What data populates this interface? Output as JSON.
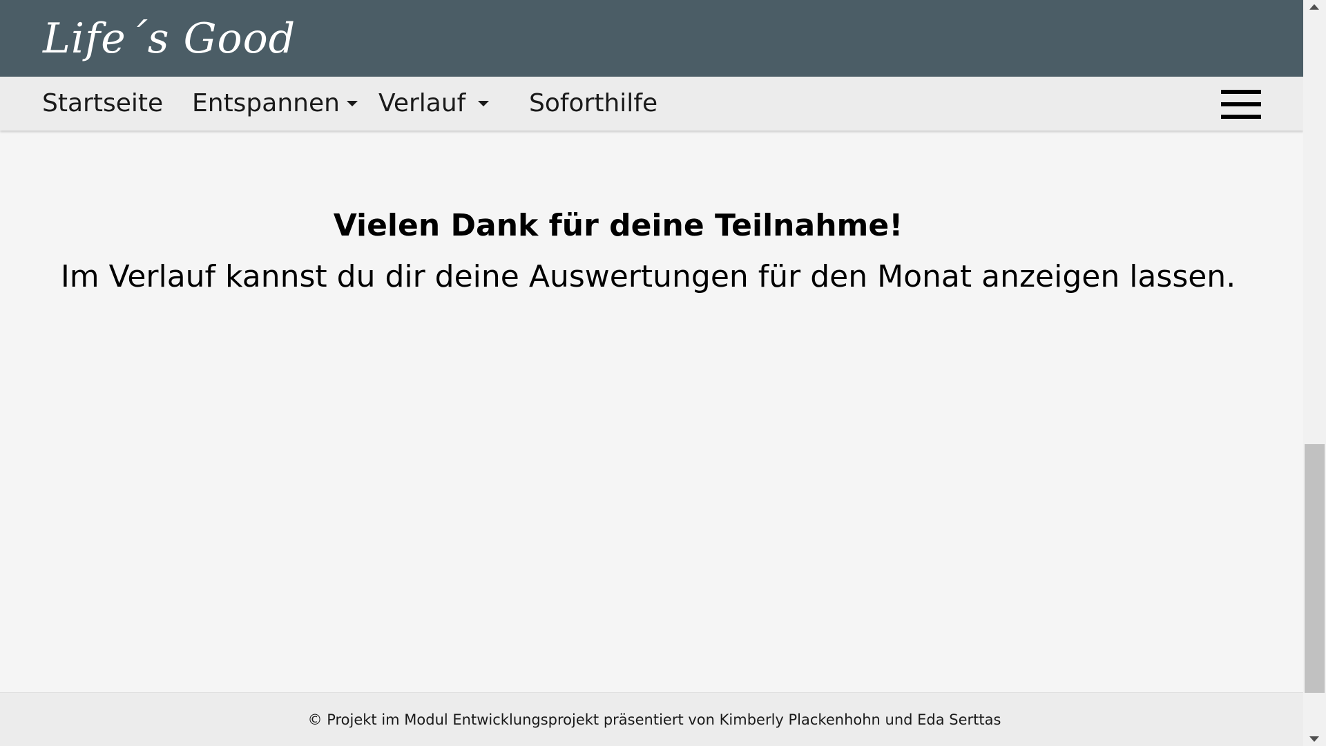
{
  "header": {
    "logo_text": "Life´s Good",
    "background_color": "#4b5d66"
  },
  "nav": {
    "items": [
      {
        "label": "Startseite",
        "has_dropdown": false
      },
      {
        "label": "Entspannen",
        "has_dropdown": true
      },
      {
        "label": "Verlauf",
        "has_dropdown": true
      },
      {
        "label": "Soforthilfe",
        "has_dropdown": false
      }
    ],
    "menu_icon": "hamburger-menu-icon",
    "dropdown_icon": "caret-down-icon",
    "background_color": "#ececec"
  },
  "main": {
    "title": "Vielen Dank für deine Teilnahme!",
    "subtitle": "Im Verlauf kannst du dir deine Auswertungen für den Monat anzeigen lassen."
  },
  "footer": {
    "text": "© Projekt im Modul Entwicklungsprojekt präsentiert von Kimberly Plackenhohn und Eda Serttas"
  },
  "scrollbar": {
    "up_icon": "scroll-up-arrow-icon",
    "down_icon": "scroll-down-arrow-icon"
  }
}
